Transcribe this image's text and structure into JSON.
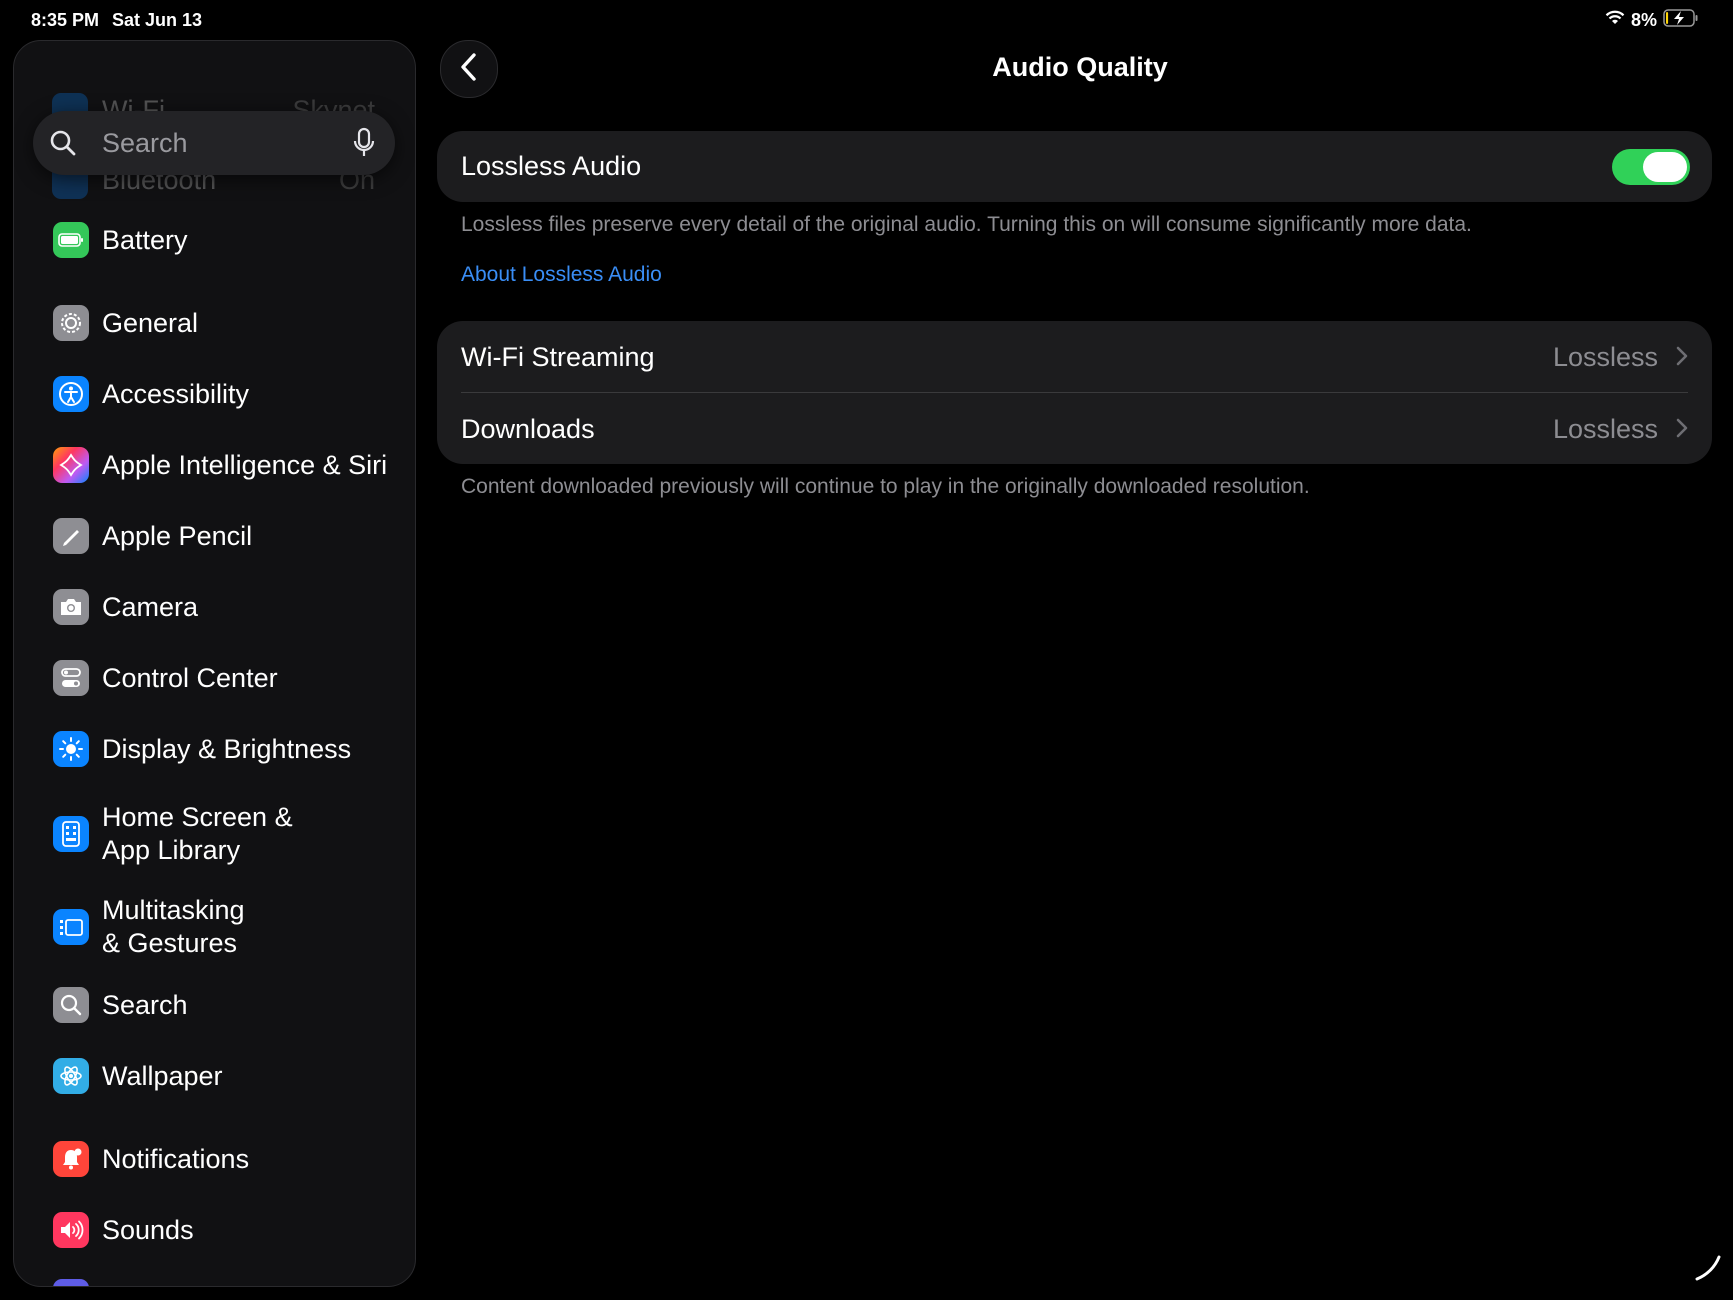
{
  "status_bar": {
    "time": "8:35 PM",
    "date": "Sat Jun 13",
    "battery_percent": "8%",
    "battery_level": 0.08,
    "charging": true
  },
  "sidebar": {
    "search": {
      "placeholder": "Search"
    },
    "partial_items": [
      {
        "label": "Wi-Fi",
        "value": "Skynet",
        "icon": "wifi-icon"
      },
      {
        "label": "Bluetooth",
        "value": "On",
        "icon": "bluetooth-icon"
      }
    ],
    "items": [
      {
        "label": "Battery",
        "icon": "battery-icon",
        "color": "#34c759"
      },
      {
        "label": "General",
        "icon": "gear-icon",
        "color": "#8e8e93"
      },
      {
        "label": "Accessibility",
        "icon": "accessibility-icon",
        "color": "#0a84ff"
      },
      {
        "label": "Apple Intelligence & Siri",
        "icon": "siri-icon",
        "color": "#bf5af2"
      },
      {
        "label": "Apple Pencil",
        "icon": "pencil-icon",
        "color": "#8e8e93"
      },
      {
        "label": "Camera",
        "icon": "camera-icon",
        "color": "#8e8e93"
      },
      {
        "label": "Control Center",
        "icon": "control-center-icon",
        "color": "#8e8e93"
      },
      {
        "label": "Display & Brightness",
        "icon": "sun-icon",
        "color": "#0a84ff"
      },
      {
        "label": "Home Screen &",
        "label2": "App Library",
        "icon": "home-screen-icon",
        "color": "#0a84ff"
      },
      {
        "label": "Multitasking",
        "label2": "& Gestures",
        "icon": "multitasking-icon",
        "color": "#0a84ff"
      },
      {
        "label": "Search",
        "icon": "search-icon",
        "color": "#8e8e93"
      },
      {
        "label": "Wallpaper",
        "icon": "wallpaper-icon",
        "color": "#32ade6"
      },
      {
        "label": "Notifications",
        "icon": "bell-icon",
        "color": "#ff453a"
      },
      {
        "label": "Sounds",
        "icon": "speaker-icon",
        "color": "#ff375f"
      }
    ]
  },
  "main": {
    "title": "Audio Quality",
    "lossless": {
      "label": "Lossless Audio",
      "enabled": true,
      "description": "Lossless files preserve every detail of the original audio. Turning this on will consume significantly more data.",
      "link": "About Lossless Audio"
    },
    "settings": [
      {
        "label": "Wi-Fi Streaming",
        "value": "Lossless"
      },
      {
        "label": "Downloads",
        "value": "Lossless"
      }
    ],
    "footer": "Content downloaded previously will continue to play in the originally downloaded resolution."
  }
}
